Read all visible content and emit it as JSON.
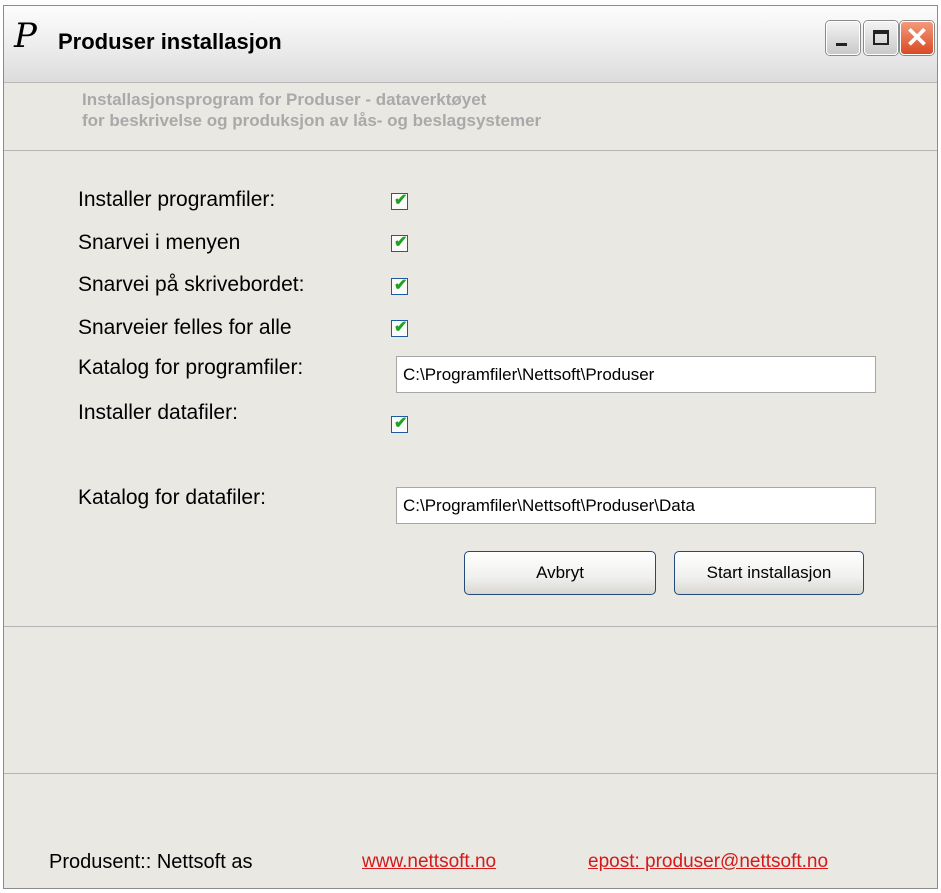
{
  "window": {
    "title": "Produser installasjon",
    "logo_glyph": "P",
    "controls": {
      "minimize_icon": "minimize-icon",
      "maximize_icon": "maximize-icon",
      "close_icon": "close-icon",
      "close_glyph": "✕"
    }
  },
  "header": {
    "line1": "Installasjonsprogram for Produser - dataverktøyet",
    "line2": "for beskrivelse og produksjon av lås- og beslagsystemer"
  },
  "options": [
    {
      "label": "Installer programfiler:",
      "checked": true
    },
    {
      "label": "Snarvei i menyen",
      "checked": true
    },
    {
      "label": "Snarvei på skrivebordet:",
      "checked": true
    },
    {
      "label": "Snarveier felles for alle",
      "checked": true
    }
  ],
  "program_dir": {
    "label": "Katalog for programfiler:",
    "value": "C:\\Programfiler\\Nettsoft\\Produser"
  },
  "data_files": {
    "label": "Installer datafiler:",
    "checked": true
  },
  "data_dir": {
    "label": "Katalog for datafiler:",
    "value": "C:\\Programfiler\\Nettsoft\\Produser\\Data"
  },
  "buttons": {
    "cancel": "Avbryt",
    "start": "Start installasjon"
  },
  "footer": {
    "producer": "Produsent:: Nettsoft as",
    "website": "www.nettsoft.no",
    "email": "epost: produser@nettsoft.no"
  },
  "colors": {
    "window_bg": "#e9e8e3",
    "header_text": "#a9a9a9",
    "check_mark": "#21a121",
    "link": "#d41a1a",
    "close_button": "#d94a22"
  },
  "check_glyph": "✔"
}
